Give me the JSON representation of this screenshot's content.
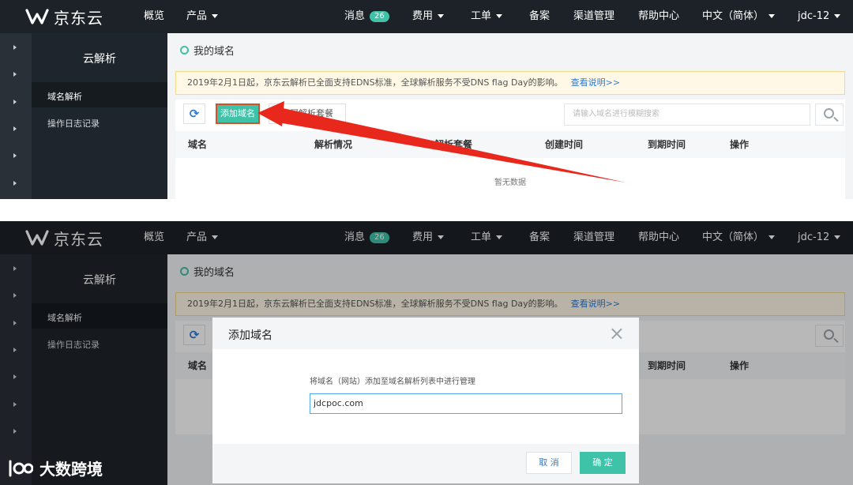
{
  "brand": {
    "logo_text": "京东云"
  },
  "nav": {
    "overview": "概览",
    "products": "产品",
    "messages": "消息",
    "messages_count": "26",
    "fees": "费用",
    "tickets": "工单",
    "filing": "备案",
    "channel": "渠道管理",
    "help": "帮助中心",
    "language": "中文（简体）",
    "user": "jdc-12"
  },
  "sidebar": {
    "title": "云解析",
    "items": [
      {
        "label": "域名解析"
      },
      {
        "label": "操作日志记录"
      }
    ]
  },
  "main": {
    "breadcrumb": "我的域名",
    "notice": "2019年2月1日起，京东云解析已全面支持EDNS标准，全球解析服务不受DNS flag Day的影响。",
    "notice_link": "查看说明>>",
    "add_domain_label": "添加域名",
    "buy_package_label": "购买解析套餐",
    "search_placeholder": "请输入域名进行模糊搜索",
    "table_headers": [
      "域名",
      "解析情况",
      "解析套餐",
      "创建时间",
      "到期时间",
      "操作"
    ],
    "empty_text": "暂无数据"
  },
  "modal": {
    "title": "添加域名",
    "label": "将域名（网站）添加至域名解析列表中进行管理",
    "input_value": "jdcpoc.com",
    "cancel_label": "取 消",
    "ok_label": "确 定"
  },
  "watermark": {
    "text": "大数跨境"
  },
  "colors": {
    "accent": "#3fc3a8",
    "nav_bg": "#1d2228",
    "highlight": "#d4522a",
    "link": "#2f7bd6"
  }
}
